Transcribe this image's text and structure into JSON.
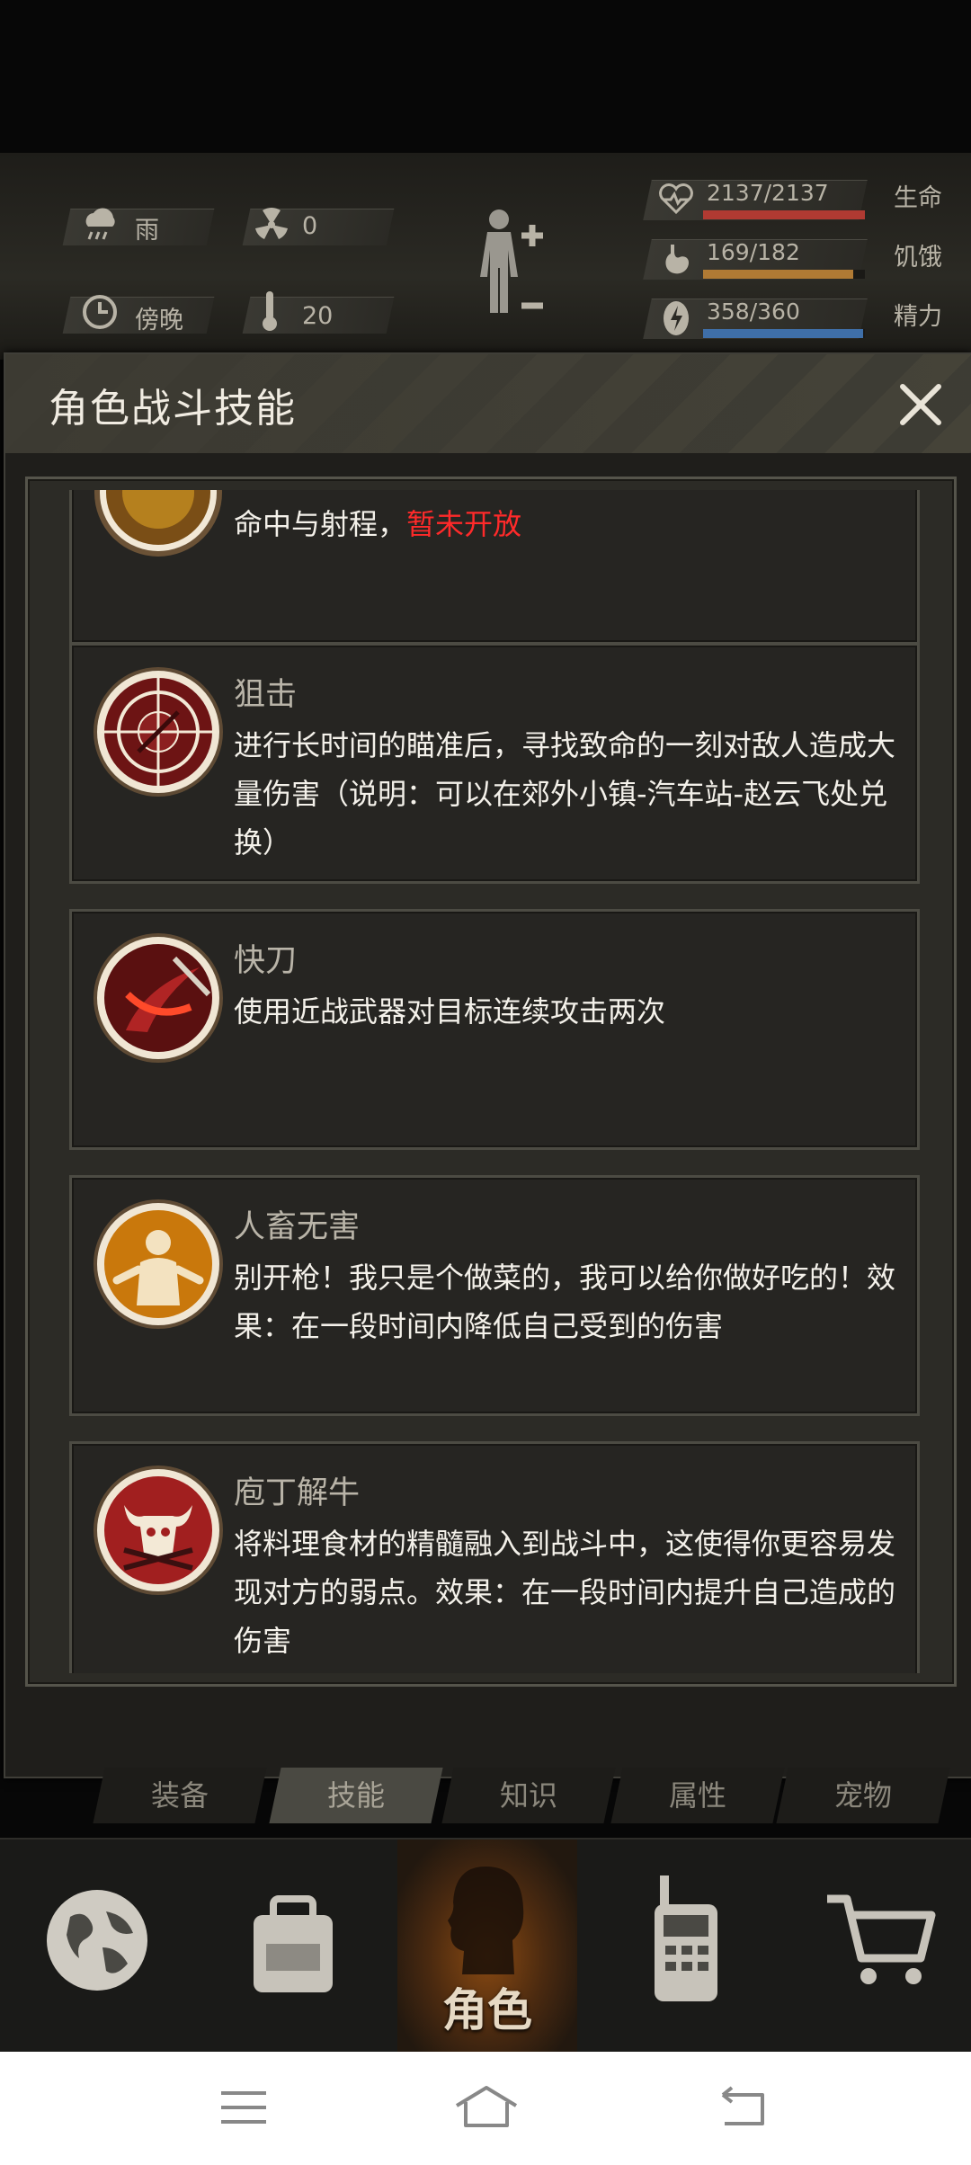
{
  "hud": {
    "weather": "雨",
    "radiation": "0",
    "time_of_day": "傍晚",
    "temperature": "20",
    "health": {
      "text": "2137/2137",
      "label": "生命",
      "fill": 1.0,
      "color": "#b03a32"
    },
    "hunger": {
      "text": "169/182",
      "label": "饥饿",
      "fill": 0.93,
      "color": "#b07a34"
    },
    "energy": {
      "text": "358/360",
      "label": "精力",
      "fill": 0.99,
      "color": "#3f6fa8"
    }
  },
  "dialog": {
    "title": "角色战斗技能",
    "skills": [
      {
        "name": "",
        "desc": "命中与射程，",
        "warn": "暂未开放",
        "icon": "aim-skill-icon"
      },
      {
        "name": "狙击",
        "desc": "进行长时间的瞄准后，寻找致命的一刻对敌人造成大量伤害（说明：可以在郊外小镇-汽车站-赵云飞处兑换）",
        "icon": "sniper-crosshair-icon"
      },
      {
        "name": "快刀",
        "desc": "使用近战武器对目标连续攻击两次",
        "icon": "quick-blade-icon"
      },
      {
        "name": "人畜无害",
        "desc": "别开枪！我只是个做菜的，我可以给你做好吃的！效果：在一段时间内降低自己受到的伤害",
        "icon": "harmless-cook-icon"
      },
      {
        "name": "庖丁解牛",
        "desc": "将料理食材的精髓融入到战斗中，这使得你更容易发现对方的弱点。效果：在一段时间内提升自己造成的伤害",
        "icon": "bull-skull-knives-icon"
      }
    ]
  },
  "tabs": [
    "装备",
    "技能",
    "知识",
    "属性",
    "宠物"
  ],
  "active_tab": "技能",
  "nav": {
    "role_label": "角色"
  }
}
